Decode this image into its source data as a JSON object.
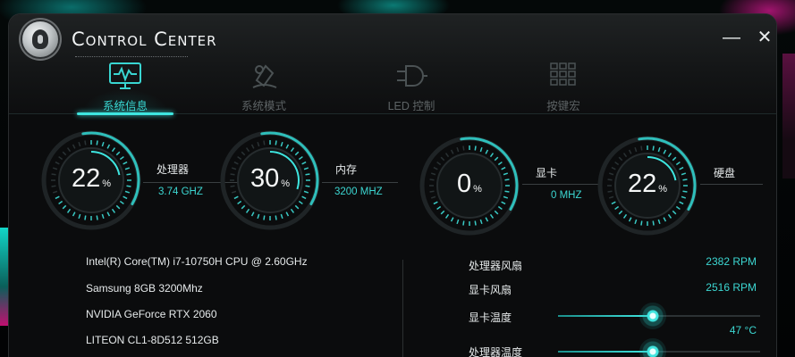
{
  "window": {
    "title": "Control Center",
    "min_label": "—",
    "close_label": "✕"
  },
  "tabs": [
    {
      "label": "系统信息",
      "icon": "monitor-icon",
      "active": true
    },
    {
      "label": "系统模式",
      "icon": "mode-icon",
      "active": false
    },
    {
      "label": "LED 控制",
      "icon": "led-icon",
      "active": false
    },
    {
      "label": "按键宏",
      "icon": "keypad-icon",
      "active": false
    }
  ],
  "gauges": [
    {
      "name": "处理器",
      "value": "22",
      "unit": "%",
      "sub": "3.74 GHZ",
      "level": 0.22
    },
    {
      "name": "内存",
      "value": "30",
      "unit": "%",
      "sub": "3200 MHZ",
      "level": 0.3
    },
    {
      "name": "显卡",
      "value": "0",
      "unit": "%",
      "sub": "0 MHZ",
      "level": 0.0
    },
    {
      "name": "硬盘",
      "value": "22",
      "unit": "%",
      "sub": "",
      "level": 0.22
    }
  ],
  "hardware": {
    "cpu": "Intel(R) Core(TM) i7-10750H CPU @ 2.60GHz",
    "memory": "Samsung 8GB 3200Mhz",
    "gpu": "NVIDIA GeForce RTX 2060",
    "disk": "LITEON CL1-8D512 512GB"
  },
  "stats": {
    "cpu_fan": {
      "label": "处理器风扇",
      "value": "2382 RPM"
    },
    "gpu_fan": {
      "label": "显卡风扇",
      "value": "2516 RPM"
    },
    "gpu_temp": {
      "label": "显卡温度",
      "value": "47 °C",
      "level": 0.47
    },
    "cpu_temp": {
      "label": "处理器温度",
      "level": 0.47
    }
  },
  "colors": {
    "accent": "#3ee6e0",
    "inactive": "#5d6365"
  }
}
